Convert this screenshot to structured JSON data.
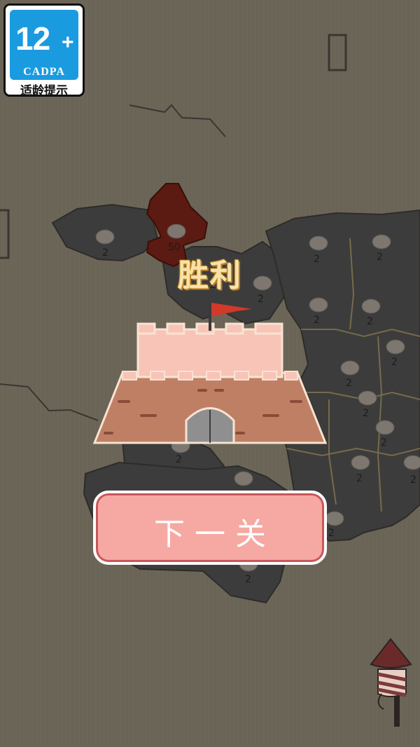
{
  "age_badge": {
    "age": "12",
    "plus": "+",
    "org": "CADPA",
    "hint": "适龄提示"
  },
  "map": {
    "highlight_count": "50",
    "territory_counts": [
      "2",
      "2",
      "2",
      "2",
      "2",
      "2",
      "2",
      "2",
      "2",
      "2",
      "2",
      "2",
      "2",
      "2",
      "2",
      "2",
      "2",
      "2"
    ]
  },
  "result": {
    "title": "胜利",
    "next_button": "下一关"
  },
  "colors": {
    "map_bg": "#6b6558",
    "player": "#5b1a12",
    "enemy": "#393939",
    "button": "#f6a8a2",
    "title_gold": "#f6e3a8"
  },
  "icons": [
    "fortress-icon",
    "flag-icon",
    "firework-rocket-icon",
    "soldier-icon"
  ]
}
